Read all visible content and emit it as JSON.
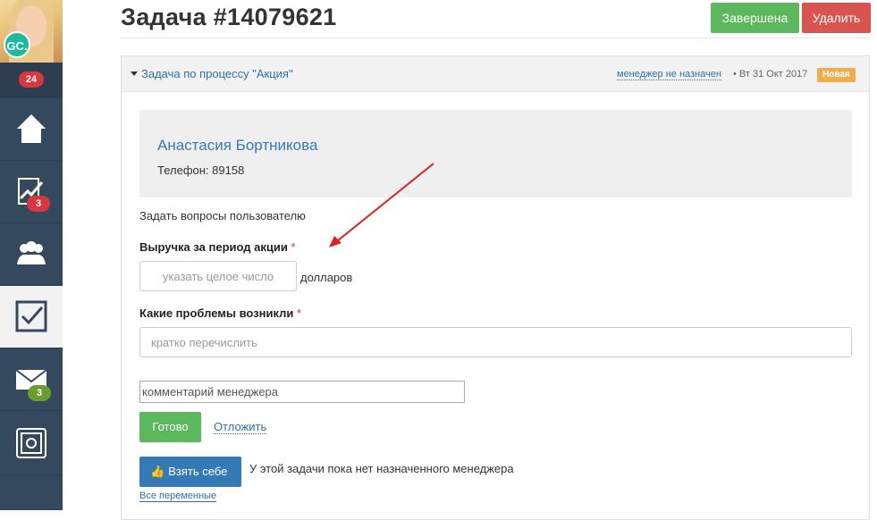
{
  "sidebar": {
    "avatar_initials": "GC.",
    "avatar_count": "24",
    "items": [
      {
        "name": "home",
        "icon": "home-icon",
        "badge": ""
      },
      {
        "name": "reports",
        "icon": "chart-icon",
        "badge": "3",
        "badge_color": "#d9363e"
      },
      {
        "name": "users",
        "icon": "users-icon",
        "badge": ""
      },
      {
        "name": "tasks",
        "icon": "checkbox-icon",
        "badge": ""
      },
      {
        "name": "messages",
        "icon": "envelope-icon",
        "badge": "3",
        "badge_color": "#6a9c2e"
      },
      {
        "name": "safe",
        "icon": "safe-icon",
        "badge": ""
      }
    ]
  },
  "header": {
    "title": "Задача #14079621",
    "done_label": "Завершена",
    "delete_label": "Удалить"
  },
  "panel": {
    "process_link": "Задача по процессу \"Акция\"",
    "manager_link": "менеджер не назначен",
    "date_text": "• Вт 31 Окт 2017",
    "status_badge": "Новая"
  },
  "contact": {
    "name": "Анастасия Бортникова",
    "phone": "Телефон: 89158"
  },
  "form": {
    "ask_text": "Задать вопросы пользователю",
    "revenue_label": "Выручка за период акции",
    "revenue_placeholder": "указать целое число",
    "revenue_unit": "долларов",
    "problems_label": "Какие проблемы возникли",
    "problems_placeholder": "кратко перечислить",
    "comment_placeholder": "комментарий менеджера",
    "required_mark": "*"
  },
  "actions": {
    "ready_label": "Готово",
    "postpone_label": "Отложить",
    "take_label": "Взять себе",
    "no_manager_text": "У этой задачи пока нет назначенного менеджера",
    "all_vars_link": "Все переменные"
  },
  "colors": {
    "sidebar_bg": "#34495e",
    "success": "#5cb85c",
    "danger": "#d9534f",
    "primary": "#337ab7",
    "link": "#2f6fa8",
    "badge_new": "#f0ad4e",
    "annotation_arrow": "#e02020"
  }
}
